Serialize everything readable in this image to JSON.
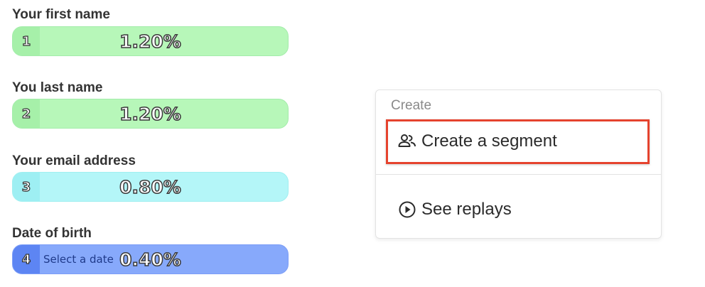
{
  "fields": [
    {
      "label": "Your first name",
      "index": "1",
      "percent": "1.20%",
      "placeholder": "",
      "color": "#b7f7b9"
    },
    {
      "label": "You last name",
      "index": "2",
      "percent": "1.20%",
      "placeholder": "",
      "color": "#b7f7b9"
    },
    {
      "label": "Your email address",
      "index": "3",
      "percent": "0.80%",
      "placeholder": "",
      "color": "#b4f6f8"
    },
    {
      "label": "Date of birth",
      "index": "4",
      "percent": "0.40%",
      "placeholder": "Select a date",
      "color": "#87a9fb"
    }
  ],
  "menu": {
    "header": "Create",
    "items": [
      {
        "label": "Create a segment",
        "icon": "people-icon"
      },
      {
        "label": "See replays",
        "icon": "play-circle-icon"
      }
    ],
    "highlight_color": "#e5432e"
  }
}
